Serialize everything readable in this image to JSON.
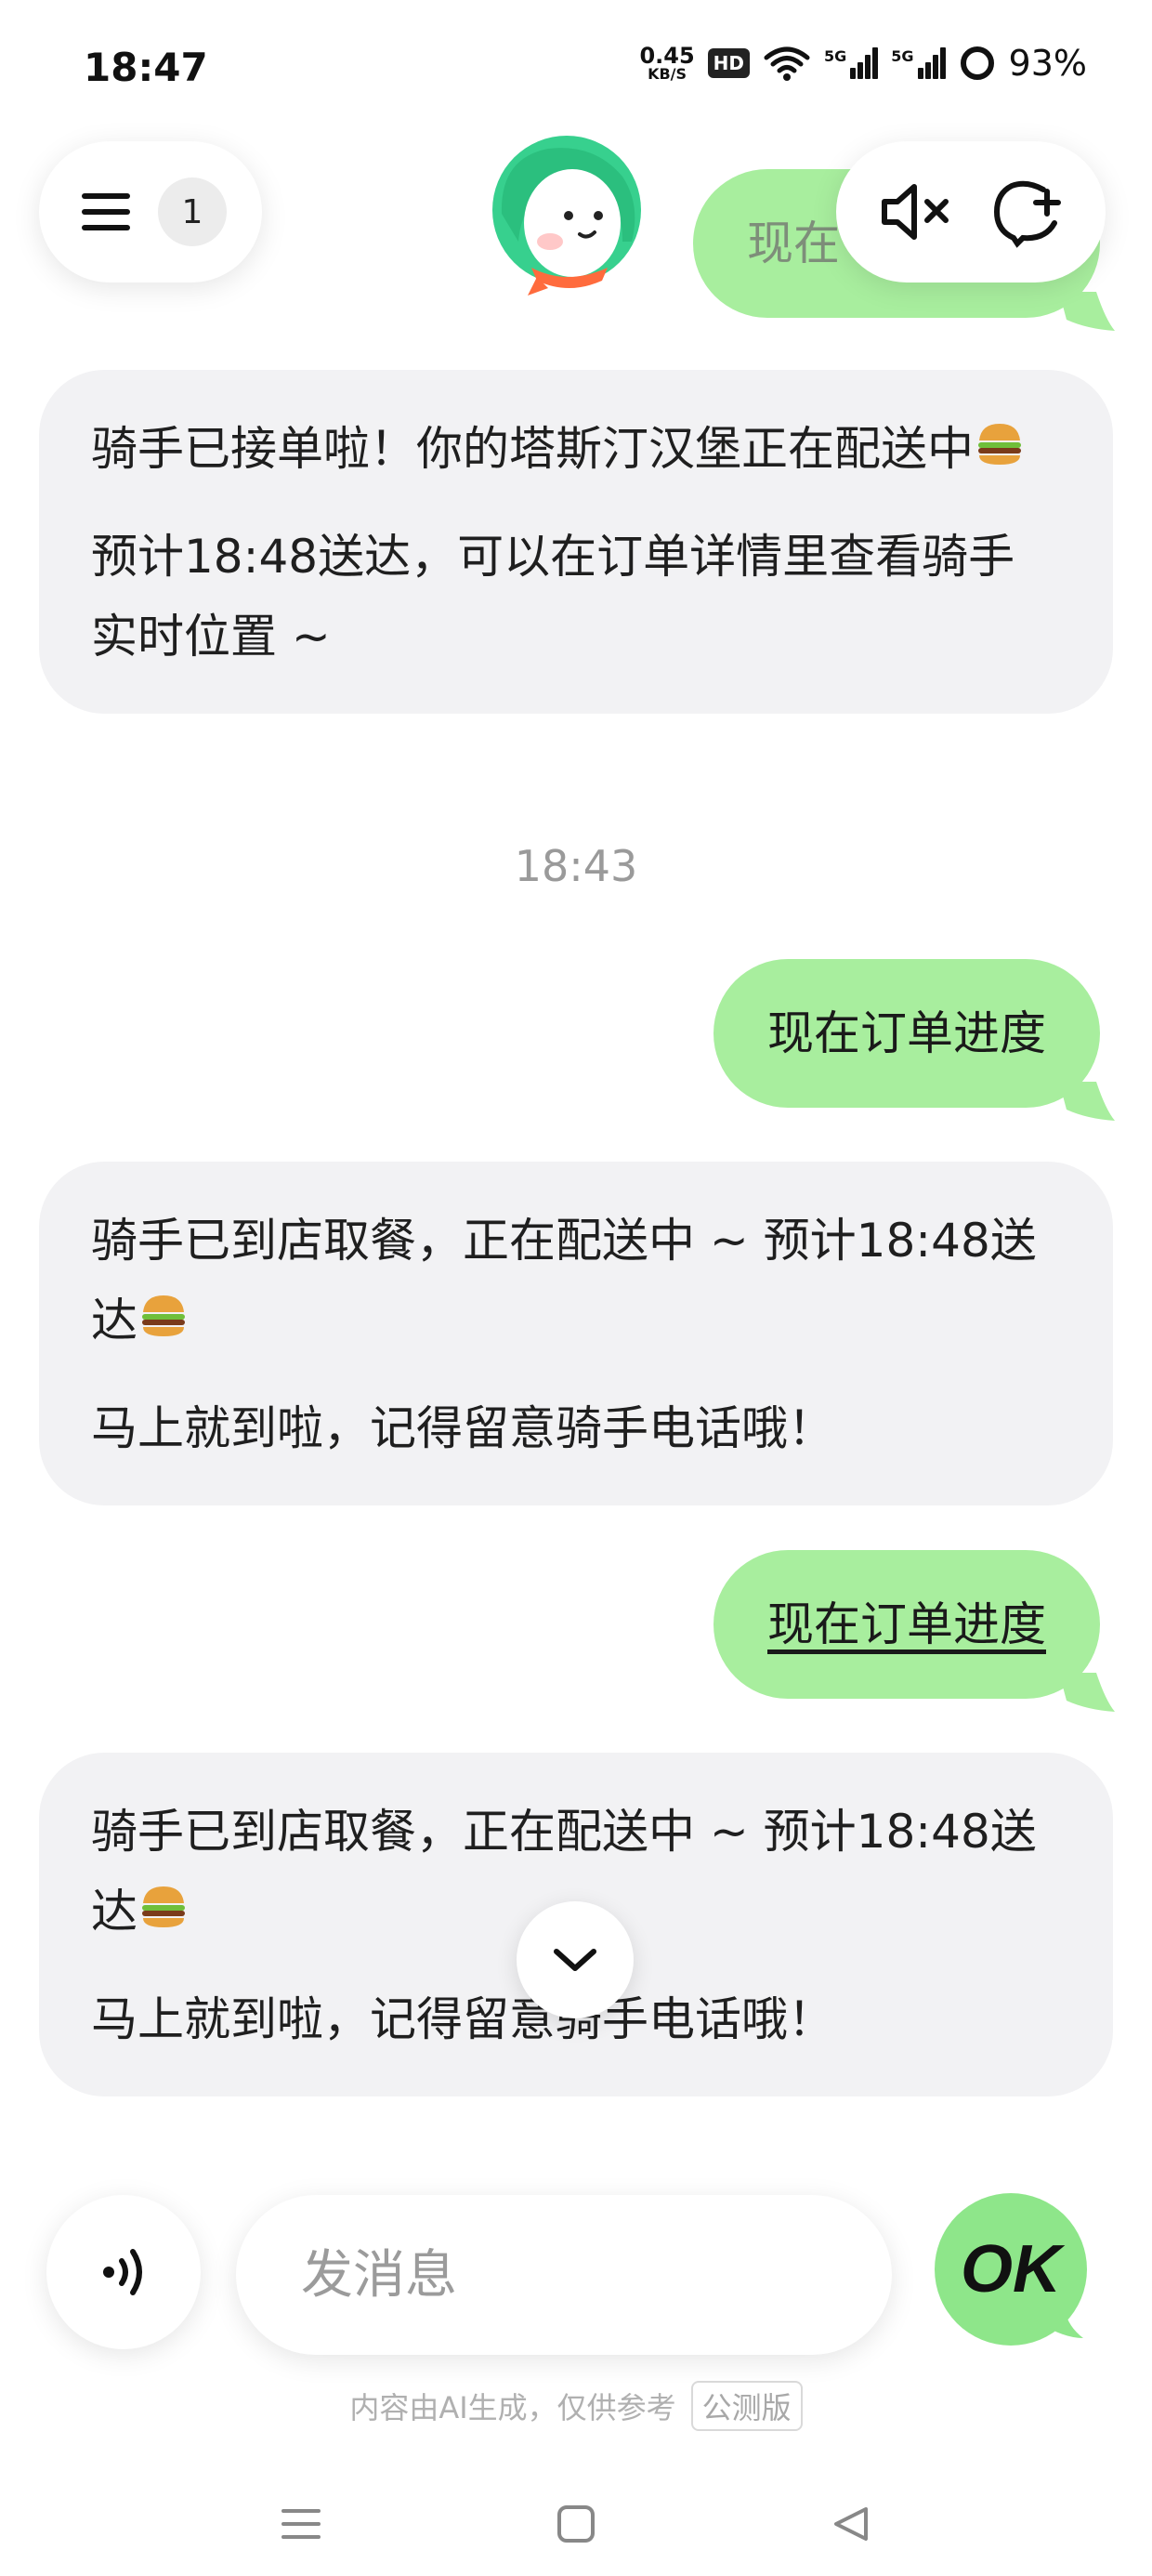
{
  "status_bar": {
    "time": "18:47",
    "net_speed_value": "0.45",
    "net_speed_unit": "KB/S",
    "hd_label": "HD",
    "signal1_label": "5G",
    "signal2_label": "5G",
    "battery": "93%"
  },
  "header": {
    "session_count": "1"
  },
  "messages": {
    "user_top_partial": "现在",
    "ai1_line1": "骑手已接单啦！你的塔斯汀汉堡正在配送中",
    "ai1_line2": "预计18:48送达，可以在订单详情里查看骑手实时位置 ~",
    "timestamp": "18:43",
    "user2": "现在订单进度",
    "ai2_line1": "骑手已到店取餐，正在配送中 ~ 预计18:48送达",
    "ai2_line2": "马上就到啦，记得留意骑手电话哦！",
    "user3": "现在订单进度",
    "ai3_line1": "骑手已到店取餐，正在配送中 ~ 预计18:48送达",
    "ai3_line2": "马上就到啦，记得留意骑手电话哦！"
  },
  "input": {
    "placeholder": "发消息",
    "send_label": "OK"
  },
  "footer": {
    "disclaimer": "内容由AI生成，仅供参考",
    "beta_label": "公测版"
  },
  "colors": {
    "user_bubble": "#a8ee9e",
    "ai_bubble": "#f2f2f4",
    "accent_green": "#8ee68a"
  }
}
